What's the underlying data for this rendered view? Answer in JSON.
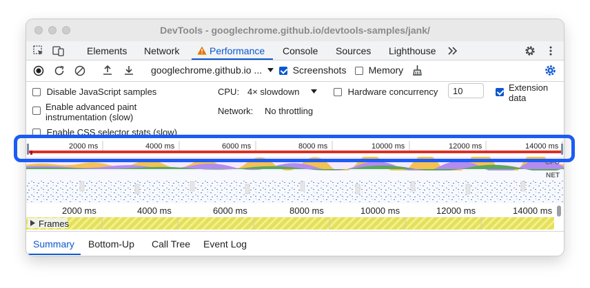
{
  "window": {
    "title": "DevTools - googlechrome.github.io/devtools-samples/jank/"
  },
  "tabs": [
    {
      "label": "Elements"
    },
    {
      "label": "Network"
    },
    {
      "label": "Performance",
      "active": true,
      "warning_icon": "warning-triangle-icon"
    },
    {
      "label": "Console"
    },
    {
      "label": "Sources"
    },
    {
      "label": "Lighthouse"
    }
  ],
  "toolbar": {
    "url_select": "googlechrome.github.io ...",
    "screenshots_label": "Screenshots",
    "screenshots_checked": true,
    "memory_label": "Memory",
    "memory_checked": false
  },
  "settings": {
    "disable_js_label": "Disable JavaScript samples",
    "advanced_paint_label_1": "Enable advanced paint",
    "advanced_paint_label_2": "instrumentation (slow)",
    "css_selector_label": "Enable CSS selector stats (slow)",
    "cpu_label": "CPU:",
    "cpu_value": "4× slowdown",
    "network_label": "Network:",
    "network_value": "No throttling",
    "hardware_label": "Hardware concurrency",
    "hardware_value": "10",
    "extension_label_1": "Extension",
    "extension_label_2": "data",
    "extension_checked": true
  },
  "timeline": {
    "ticks": [
      "2000 ms",
      "4000 ms",
      "6000 ms",
      "8000 ms",
      "10000 ms",
      "12000 ms",
      "14000 ms"
    ],
    "cpu_label": "CPU",
    "net_label": "NET",
    "frames_label": "Frames"
  },
  "bottom_tabs": [
    {
      "label": "Summary",
      "active": true
    },
    {
      "label": "Bottom-Up"
    },
    {
      "label": "Call Tree"
    },
    {
      "label": "Event Log"
    }
  ],
  "colors": {
    "accent": "#0b57d0",
    "highlight": "#1a5cf4",
    "jank_red": "#d93025",
    "frames_yellow": "#e4e05a"
  }
}
